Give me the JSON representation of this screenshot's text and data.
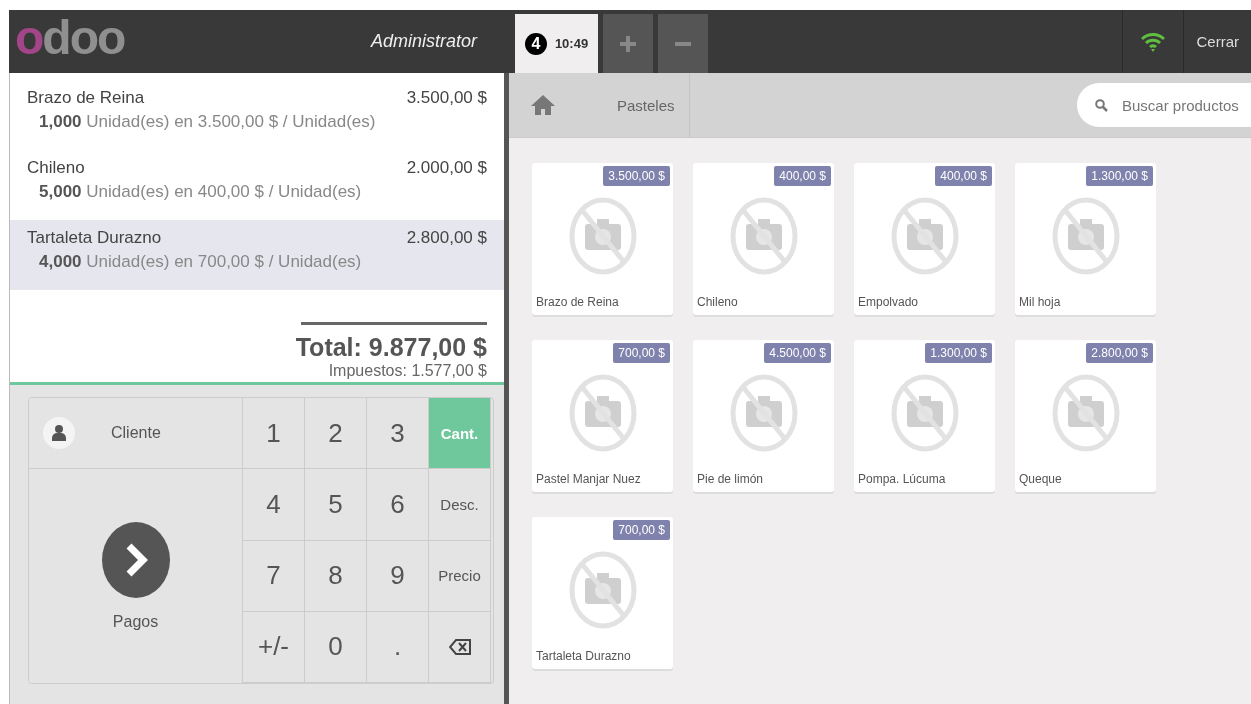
{
  "header": {
    "logo": {
      "accent": "o",
      "rest": "doo"
    },
    "user": "Administrator",
    "orders": [
      {
        "number": "4",
        "time": "10:49",
        "selected": true
      }
    ],
    "close": "Cerrar"
  },
  "order": {
    "lines": [
      {
        "name": "Brazo de Reina",
        "price": "3.500,00 $",
        "detail": "**1,000** Unidad(es) en 3.500,00 $ / Unidad(es)",
        "selected": false
      },
      {
        "name": "Chileno",
        "price": "2.000,00 $",
        "detail": "**5,000** Unidad(es) en 400,00 $ / Unidad(es)",
        "selected": false
      },
      {
        "name": "Tartaleta Durazno",
        "price": "2.800,00 $",
        "detail": "**4,000** Unidad(es) en 700,00 $ / Unidad(es)",
        "selected": true
      }
    ],
    "total": "Total: 9.877,00 $",
    "taxes": "Impuestos: 1.577,00 $"
  },
  "actions": {
    "customer": "Cliente",
    "payment": "Pagos"
  },
  "numpad": [
    {
      "kind": "digit",
      "label": "1"
    },
    {
      "kind": "digit",
      "label": "2"
    },
    {
      "kind": "digit",
      "label": "3"
    },
    {
      "kind": "mode",
      "label": "Cant.",
      "selected": true
    },
    {
      "kind": "digit",
      "label": "4"
    },
    {
      "kind": "digit",
      "label": "5"
    },
    {
      "kind": "digit",
      "label": "6"
    },
    {
      "kind": "mode",
      "label": "Desc.",
      "selected": false
    },
    {
      "kind": "digit",
      "label": "7"
    },
    {
      "kind": "digit",
      "label": "8"
    },
    {
      "kind": "digit",
      "label": "9"
    },
    {
      "kind": "mode",
      "label": "Precio",
      "selected": false
    },
    {
      "kind": "digit",
      "label": "+/-"
    },
    {
      "kind": "digit",
      "label": "0"
    },
    {
      "kind": "digit",
      "label": "."
    },
    {
      "kind": "backspace"
    }
  ],
  "breadcrumb": {
    "category": "Pasteles"
  },
  "search": {
    "placeholder": "Buscar productos"
  },
  "products": [
    {
      "name": "Brazo de Reina",
      "price": "3.500,00 $"
    },
    {
      "name": "Chileno",
      "price": "400,00 $"
    },
    {
      "name": "Empolvado",
      "price": "400,00 $"
    },
    {
      "name": "Mil hoja",
      "price": "1.300,00 $"
    },
    {
      "name": "Pastel Manjar Nuez",
      "price": "700,00 $"
    },
    {
      "name": "Pie de limón",
      "price": "4.500,00 $"
    },
    {
      "name": "Pompa. Lúcuma",
      "price": "1.300,00 $"
    },
    {
      "name": "Queque",
      "price": "2.800,00 $"
    },
    {
      "name": "Tartaleta Durazno",
      "price": "700,00 $"
    }
  ]
}
